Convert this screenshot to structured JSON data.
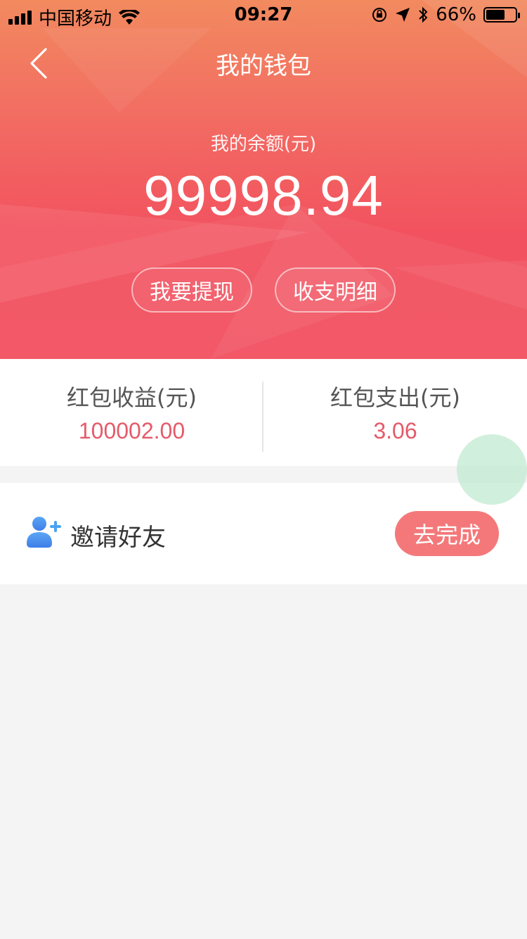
{
  "status_bar": {
    "carrier": "中国移动",
    "time": "09:27",
    "battery_percent": "66%",
    "battery_level": 0.66,
    "icons": [
      "signal-icon",
      "wifi-icon",
      "orientation-lock-icon",
      "location-arrow-icon",
      "bluetooth-icon",
      "battery-icon"
    ]
  },
  "nav": {
    "title": "我的钱包",
    "back_icon": "chevron-left-icon"
  },
  "balance": {
    "label": "我的余额(元)",
    "value": "99998.94"
  },
  "actions": {
    "withdraw": "我要提现",
    "details": "收支明细"
  },
  "stats": {
    "income_label": "红包收益(元)",
    "income_value": "100002.00",
    "expense_label": "红包支出(元)",
    "expense_value": "3.06"
  },
  "invite": {
    "icon": "add-user-icon",
    "label": "邀请好友",
    "button": "去完成"
  },
  "colors": {
    "header_top": "#f28a5f",
    "header_bottom": "#f2505f",
    "value_red": "#e55a6a",
    "button_red": "#f4787a",
    "icon_blue": "#4a8ef0",
    "background": "#f4f4f4"
  }
}
